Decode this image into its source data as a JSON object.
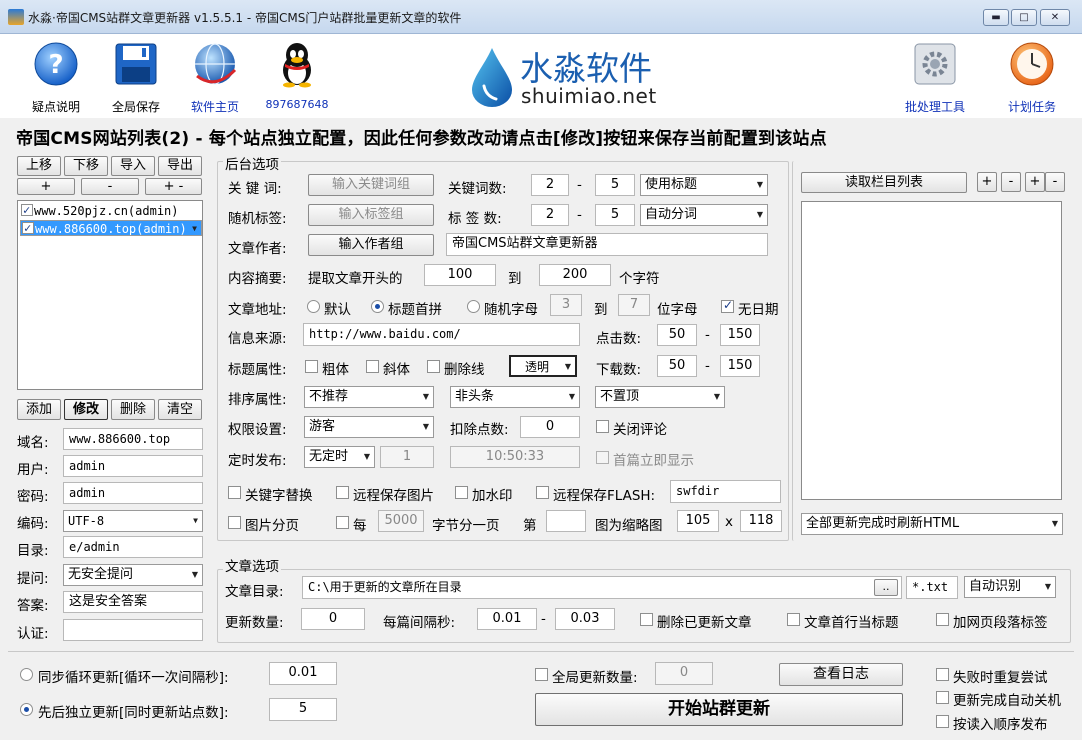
{
  "window": {
    "title": "水淼·帝国CMS站群文章更新器 v1.5.5.1 - 帝国CMS门户站群批量更新文章的软件",
    "minimize": "▬",
    "maximize": "□",
    "close": "✕"
  },
  "toolbar": {
    "help": "疑点说明",
    "save_all": "全局保存",
    "homepage": "软件主页",
    "qq": "897687648",
    "brand_cn": "水淼软件",
    "brand_en": "shuimiao.net",
    "batch": "批处理工具",
    "schedule": "计划任务"
  },
  "heading": "帝国CMS网站列表(2) - 每个站点独立配置，因此任何参数改动请点击[修改]按钮来保存当前配置到该站点",
  "sites": {
    "btn_up": "上移",
    "btn_down": "下移",
    "btn_import": "导入",
    "btn_export": "导出",
    "btn_plus": "+",
    "btn_minus": "-",
    "btn_plusminus": "+ -",
    "items": [
      {
        "label": "www.520pjz.cn(admin)",
        "checked": true,
        "selected": false
      },
      {
        "label": "www.886600.top(admin)",
        "checked": true,
        "selected": true
      }
    ],
    "btn_add": "添加",
    "btn_modify": "修改",
    "btn_delete": "删除",
    "btn_clear": "清空",
    "domain_label": "域名:",
    "domain": "www.886600.top",
    "user_label": "用户:",
    "user": "admin",
    "password_label": "密码:",
    "password": "admin",
    "encoding_label": "编码:",
    "encoding": "UTF-8",
    "dir_label": "目录:",
    "dir": "e/admin",
    "question_label": "提问:",
    "question": "无安全提问",
    "answer_label": "答案:",
    "answer": "这是安全答案",
    "auth_label": "认证:",
    "auth": ""
  },
  "backend": {
    "title": "后台选项",
    "keyword_label": "关 键 词:",
    "keyword_btn": "输入关键词组",
    "keyword_count_label": "关键词数:",
    "keyword_min": "2",
    "keyword_max": "5",
    "dash": "-",
    "keyword_mode": "使用标题",
    "tag_label": "随机标签:",
    "tag_btn": "输入标签组",
    "tag_count_label": "标 签 数:",
    "tag_min": "2",
    "tag_max": "5",
    "tag_mode": "自动分词",
    "author_label": "文章作者:",
    "author_btn": "输入作者组",
    "author_value": "帝国CMS站群文章更新器",
    "summary_label": "内容摘要:",
    "summary_text": "提取文章开头的",
    "summary_from": "100",
    "summary_to_label": "到",
    "summary_to": "200",
    "summary_unit": "个字符",
    "url_label": "文章地址:",
    "url_default": "默认",
    "url_pinyin": "标题首拼",
    "url_random": "随机字母",
    "url_min": "3",
    "url_to": "到",
    "url_max": "7",
    "url_unit": "位字母",
    "no_date": "无日期",
    "source_label": "信息来源:",
    "source": "http://www.baidu.com/",
    "clicks_label": "点击数:",
    "clicks_min": "50",
    "clicks_max": "150",
    "title_attr_label": "标题属性:",
    "bold": "粗体",
    "italic": "斜体",
    "strike": "删除线",
    "color": "透明",
    "downloads_label": "下载数:",
    "downloads_min": "50",
    "downloads_max": "150",
    "sort_label": "排序属性:",
    "recommend": "不推荐",
    "headline": "非头条",
    "top": "不置顶",
    "perm_label": "权限设置:",
    "perm": "游客",
    "deduct_label": "扣除点数:",
    "deduct": "0",
    "close_comment": "关闭评论",
    "timed_label": "定时发布:",
    "timed_mode": "无定时",
    "timed_value": "1",
    "timed_time": "10:50:33",
    "first_show": "首篇立即显示",
    "kw_replace": "关键字替换",
    "remote_img": "远程保存图片",
    "watermark": "加水印",
    "remote_flash": "远程保存FLASH:",
    "flash_dir": "swfdir",
    "img_page": "图片分页",
    "per": "每",
    "per_bytes": "5000",
    "per_unit": "字节分一页",
    "nth": "第",
    "nth_value": "",
    "thumb_label": "图为缩略图",
    "thumb_w": "105",
    "thumb_x": "x",
    "thumb_h": "118"
  },
  "columns": {
    "read_btn": "读取栏目列表",
    "plus": "+",
    "minus": "-",
    "plus2": "+",
    "minus2": "-",
    "refresh": "全部更新完成时刷新HTML"
  },
  "article": {
    "title": "文章选项",
    "dir_label": "文章目录:",
    "dir": "C:\\用于更新的文章所在目录",
    "browse": "..",
    "ext": "*.txt",
    "detect": "自动识别",
    "count_label": "更新数量:",
    "count": "0",
    "interval_label": "每篇间隔秒:",
    "interval_min": "0.01",
    "interval_max": "0.03",
    "delete_updated": "删除已更新文章",
    "first_line_title": "文章首行当标题",
    "para_tag": "加网页段落标签"
  },
  "bottom": {
    "sync_label": "同步循环更新[循环一次间隔秒]:",
    "sync_value": "0.01",
    "seq_label": "先后独立更新[同时更新站点数]:",
    "seq_value": "5",
    "global_count_label": "全局更新数量:",
    "global_count": "0",
    "view_log": "查看日志",
    "start": "开始站群更新",
    "retry": "失败时重复尝试",
    "shutdown": "更新完成自动关机",
    "order": "按读入顺序发布"
  }
}
